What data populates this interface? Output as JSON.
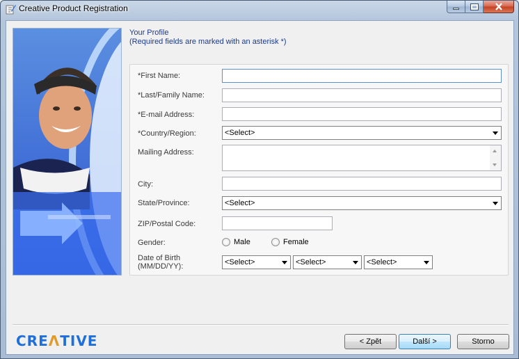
{
  "window": {
    "title": "Creative Product Registration",
    "icon": "registration-app-icon"
  },
  "header": {
    "line1": "Your Profile",
    "line2": "(Required fields are marked with an asterisk *)"
  },
  "form": {
    "first_name": {
      "label": "*First Name:",
      "value": ""
    },
    "last_name": {
      "label": "*Last/Family Name:",
      "value": ""
    },
    "email": {
      "label": "*E-mail Address:",
      "value": ""
    },
    "country": {
      "label": "*Country/Region:",
      "value": "<Select>"
    },
    "mailing": {
      "label": "Mailing Address:",
      "value": ""
    },
    "city": {
      "label": "City:",
      "value": ""
    },
    "state": {
      "label": "State/Province:",
      "value": "<Select>"
    },
    "zip": {
      "label": "ZIP/Postal Code:",
      "value": ""
    },
    "gender": {
      "label": "Gender:",
      "male": "Male",
      "female": "Female"
    },
    "dob": {
      "label_line1": "Date of Birth",
      "label_line2": "(MM/DD/YY):",
      "month": "<Select>",
      "day": "<Select>",
      "year": "<Select>"
    }
  },
  "footer": {
    "logo_pre": "CRE",
    "logo_a": "Λ",
    "logo_post": "TIVE",
    "back": "< Zpět",
    "next": "Další >",
    "cancel": "Storno"
  },
  "colors": {
    "accent": "#1f6fd8",
    "header_text": "#1a3a8a"
  }
}
